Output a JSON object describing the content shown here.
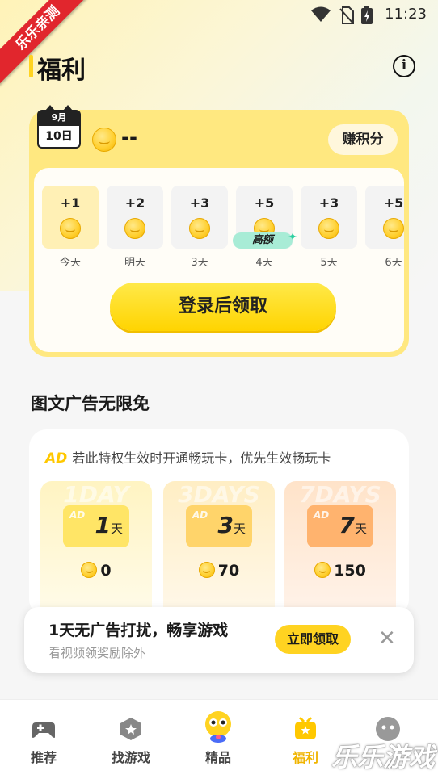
{
  "status_bar": {
    "time": "11:23"
  },
  "ribbon": {
    "text": "乐乐亲测"
  },
  "header": {
    "title": "福利",
    "info_icon": "info-icon"
  },
  "checkin": {
    "calendar_month": "9月",
    "calendar_day": "10日",
    "balance": "--",
    "earn_button": "赚积分",
    "days": [
      {
        "points": "+1",
        "label": "今天"
      },
      {
        "points": "+2",
        "label": "明天"
      },
      {
        "points": "+3",
        "label": "3天"
      },
      {
        "points": "+5",
        "label": "4天",
        "tag": "高额"
      },
      {
        "points": "+3",
        "label": "5天"
      },
      {
        "points": "+5",
        "label": "6天"
      }
    ],
    "login_button": "登录后领取"
  },
  "ad_section": {
    "title": "图文广告无限免",
    "note_logo": "AD",
    "note": "若此特权生效时开通畅玩卡，优先生效畅玩卡",
    "passes": [
      {
        "watermark": "1DAY",
        "ticket_logo": "AD",
        "days": "1",
        "unit": "天",
        "price": "0",
        "color": "#ffe566"
      },
      {
        "watermark": "3DAYS",
        "ticket_logo": "AD",
        "days": "3",
        "unit": "天",
        "price": "70",
        "color": "#ffd46a"
      },
      {
        "watermark": "7DAYS",
        "ticket_logo": "AD",
        "days": "7",
        "unit": "天",
        "price": "150",
        "color": "#ffb36e"
      }
    ]
  },
  "toast": {
    "title": "1天无广告打扰，畅享游戏",
    "subtitle": "看视频领奖励除外",
    "claim_button": "立即领取"
  },
  "tabbar": {
    "tabs": [
      {
        "label": "推荐",
        "icon": "gamepad-icon"
      },
      {
        "label": "找游戏",
        "icon": "find-game-icon"
      },
      {
        "label": "精品",
        "icon": "mascot-icon"
      },
      {
        "label": "福利",
        "icon": "gift-icon",
        "active": true
      },
      {
        "label": "",
        "icon": "face-icon"
      }
    ]
  },
  "corner_watermark": "乐乐游戏"
}
